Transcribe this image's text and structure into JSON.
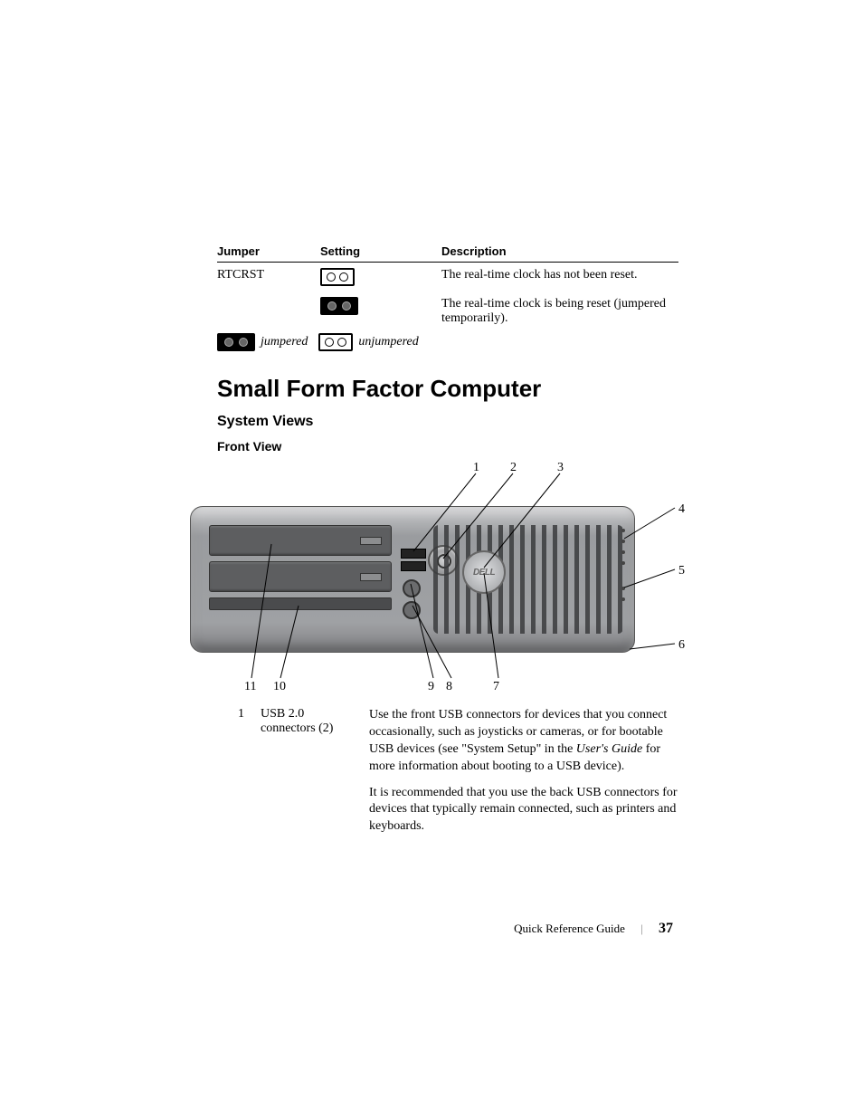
{
  "table": {
    "headers": {
      "jumper": "Jumper",
      "setting": "Setting",
      "description": "Description"
    },
    "rows": [
      {
        "jumper": "RTCRST",
        "desc": "The real-time clock has not been reset."
      },
      {
        "jumper": "",
        "desc": "The real-time clock is being reset (jumpered temporarily)."
      }
    ],
    "legend": {
      "jumpered": "jumpered",
      "unjumpered": "unjumpered"
    }
  },
  "headings": {
    "h1": "Small Form Factor Computer",
    "h2": "System Views",
    "h3": "Front View"
  },
  "callouts": {
    "c1": "1",
    "c2": "2",
    "c3": "3",
    "c4": "4",
    "c5": "5",
    "c6": "6",
    "c7": "7",
    "c8": "8",
    "c9": "9",
    "c10": "10",
    "c11": "11"
  },
  "badge": "DELL",
  "item": {
    "num": "1",
    "label": "USB 2.0 connectors (2)",
    "desc1a": "Use the front USB connectors for devices that you connect occasionally, such as joysticks or cameras, or for bootable USB devices (see \"System Setup\" in the ",
    "desc1b": "User's Guide",
    "desc1c": " for more information about booting to a USB device).",
    "desc2": "It is recommended that you use the back USB connectors for devices that typically remain connected, such as printers and keyboards."
  },
  "footer": {
    "title": "Quick Reference Guide",
    "page": "37"
  }
}
